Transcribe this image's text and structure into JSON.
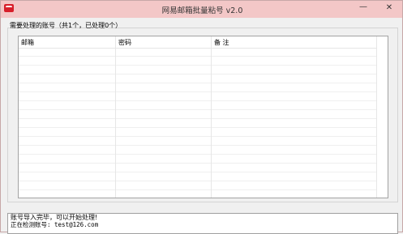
{
  "window": {
    "title": "网易邮箱批量粘号 v2.0",
    "minimize_label": "—",
    "close_label": "✕"
  },
  "accounts_group": {
    "label": "需要处理的账号（共1个，已处理0个）",
    "columns": [
      "邮箱",
      "密码",
      "备 注"
    ],
    "rows": []
  },
  "log": {
    "lines": [
      "账号导入完毕，可以开始处理!",
      "正在检测账号: test@126.com"
    ]
  },
  "colors": {
    "titlebar": "#f3c7c7",
    "app_icon": "#d71f2b",
    "window_bg": "#f0f0f0"
  },
  "icons": [
    "app-icon"
  ]
}
